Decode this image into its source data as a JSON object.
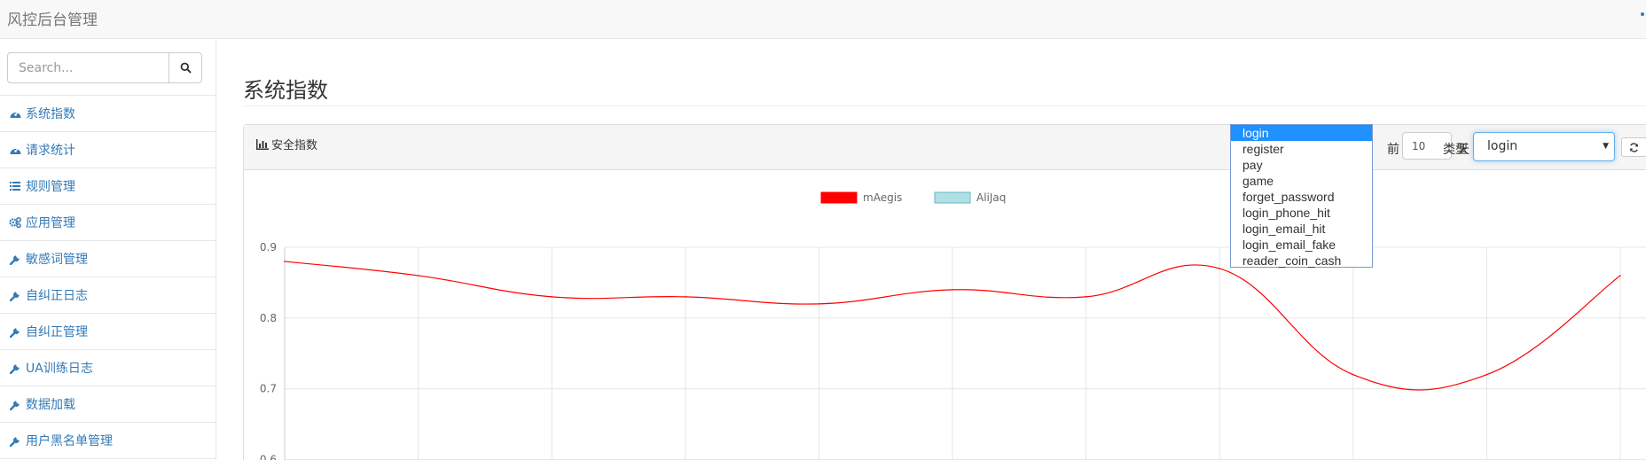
{
  "navbar": {
    "brand": "风控后台管理"
  },
  "sidebar": {
    "search_placeholder": "Search...",
    "items": [
      {
        "label": "系统指数",
        "icon": "dashboard-icon"
      },
      {
        "label": "请求统计",
        "icon": "dashboard-icon"
      },
      {
        "label": "规则管理",
        "icon": "list-icon"
      },
      {
        "label": "应用管理",
        "icon": "gears-icon"
      },
      {
        "label": "敏感词管理",
        "icon": "wrench-icon"
      },
      {
        "label": "自纠正日志",
        "icon": "wrench-icon"
      },
      {
        "label": "自纠正管理",
        "icon": "wrench-icon"
      },
      {
        "label": "UA训练日志",
        "icon": "wrench-icon"
      },
      {
        "label": "数据加载",
        "icon": "wrench-icon"
      },
      {
        "label": "用户黑名单管理",
        "icon": "wrench-icon"
      }
    ]
  },
  "main": {
    "page_title": "系统指数",
    "panel": {
      "title": "安全指数",
      "title_icon": "bar-chart-icon",
      "days_prefix": "前",
      "days_value": "10",
      "days_suffix": "天",
      "type_label": "类型",
      "type_selected": "login",
      "type_options": [
        "login",
        "register",
        "pay",
        "game",
        "forget_password",
        "login_phone_hit",
        "login_email_hit",
        "login_email_fake",
        "reader_coin_cash"
      ],
      "refresh_icon": "refresh-icon"
    }
  },
  "colors": {
    "link": "#337ab7",
    "series_mAegis": "#ff0000",
    "series_AliJaq": "#b0e0e6",
    "dropdown_highlight": "#1e90ff"
  },
  "chart_data": {
    "type": "line",
    "legend": [
      "mAegis",
      "AliJaq"
    ],
    "legend_position": "top-center",
    "grid": true,
    "ylim": [
      0.6,
      0.9
    ],
    "yticks": [
      "0.9",
      "0.8",
      "0.7",
      "0.6"
    ],
    "series": [
      {
        "name": "mAegis",
        "values": [
          0.88,
          0.86,
          0.83,
          0.83,
          0.82,
          0.84,
          0.83,
          0.87,
          0.72,
          0.72,
          0.86
        ]
      },
      {
        "name": "AliJaq",
        "values": []
      }
    ]
  }
}
